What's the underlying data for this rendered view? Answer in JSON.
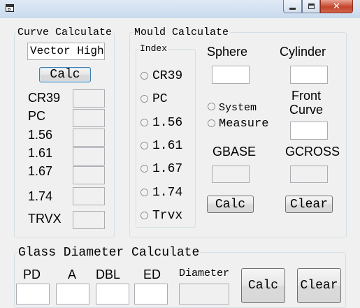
{
  "window": {
    "title": "",
    "close_glyph": "✕"
  },
  "curve": {
    "legend": "Curve Calculate",
    "input_value": "Vector Hight",
    "calc_label": "Calc",
    "rows": [
      "CR39",
      "PC",
      "1.56",
      "1.61",
      "1.67",
      "1.74",
      "TRVX"
    ]
  },
  "mould": {
    "legend": "Mould Calculate",
    "index_legend": "Index",
    "index_options": [
      "CR39",
      "PC",
      "1.56",
      "1.61",
      "1.67",
      "1.74",
      "Trvx"
    ],
    "sphere_label": "Sphere",
    "cylinder_label": "Cylinder",
    "mode_options": [
      "System",
      "Measure"
    ],
    "front_curve_label": "Front\nCurve",
    "gbase_label": "GBASE",
    "gcross_label": "GCROSS",
    "calc_label": "Calc",
    "clear_label": "Clear"
  },
  "glass": {
    "legend": "Glass Diameter Calculate",
    "fields": [
      "PD",
      "A",
      "DBL",
      "ED",
      "Diameter"
    ],
    "calc_label": "Calc",
    "clear_label": "Clear"
  }
}
